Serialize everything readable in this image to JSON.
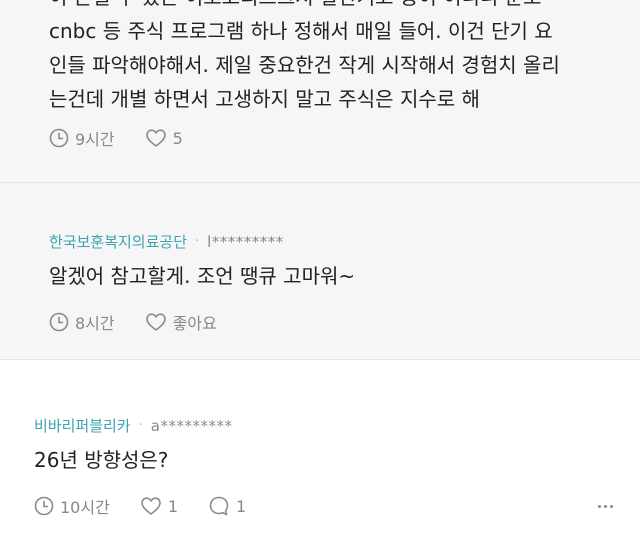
{
  "reply_1": {
    "cut_text": "이 손실 수 있는 이소코리스크서 말한거고 중이 이니니 문보",
    "lines": [
      "cnbc 등 주식 프로그램 하나 정해서 매일 들어. 이건 단기 요",
      "인들 파악해야해서. 제일 중요한건 작게 시작해서 경험치 올리",
      "는건데 개별 하면서 고생하지 말고 주식은 지수로 해"
    ],
    "time": "9시간",
    "likes": "5"
  },
  "reply_2": {
    "author": "한국보훈복지의료공단",
    "separator": "·",
    "author_id": "l*********",
    "text": "알겠어 참고할게. 조언 땡큐 고마워~",
    "time": "8시간",
    "like_label": "좋아요"
  },
  "comment_1": {
    "author": "비바리퍼블리카",
    "separator": "·",
    "author_id": "a*********",
    "text": "26년 방향성은?",
    "time": "10시간",
    "likes": "1",
    "replies": "1"
  },
  "icons": [
    "clock-icon",
    "heart-icon",
    "comment-bubble-icon",
    "more-options-icon"
  ],
  "colors": {
    "reply_background": "#f6f6f7",
    "author_accent": "#3aa4b3",
    "meta_gray": "#888888"
  }
}
